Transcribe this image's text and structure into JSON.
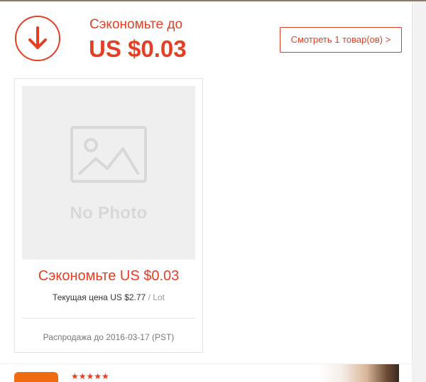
{
  "promo": {
    "save_label": "Сэкономьте до",
    "save_amount": "US $0.03",
    "icon": "arrow-down-icon",
    "view_button_label": "Смотреть 1 товар(ов) >"
  },
  "product": {
    "image_placeholder_text": "No Photo",
    "save_text": "Сэкономьте US $0.03",
    "current_price_label": "Текущая цена US $2.77",
    "unit": "/ Lot",
    "sale_until": "Распродажа до 2016-03-17 (PST)"
  },
  "next_item": {
    "rating_stars": "★★★★★"
  },
  "colors": {
    "accent": "#e43f25",
    "badge": "#f06a0f"
  }
}
